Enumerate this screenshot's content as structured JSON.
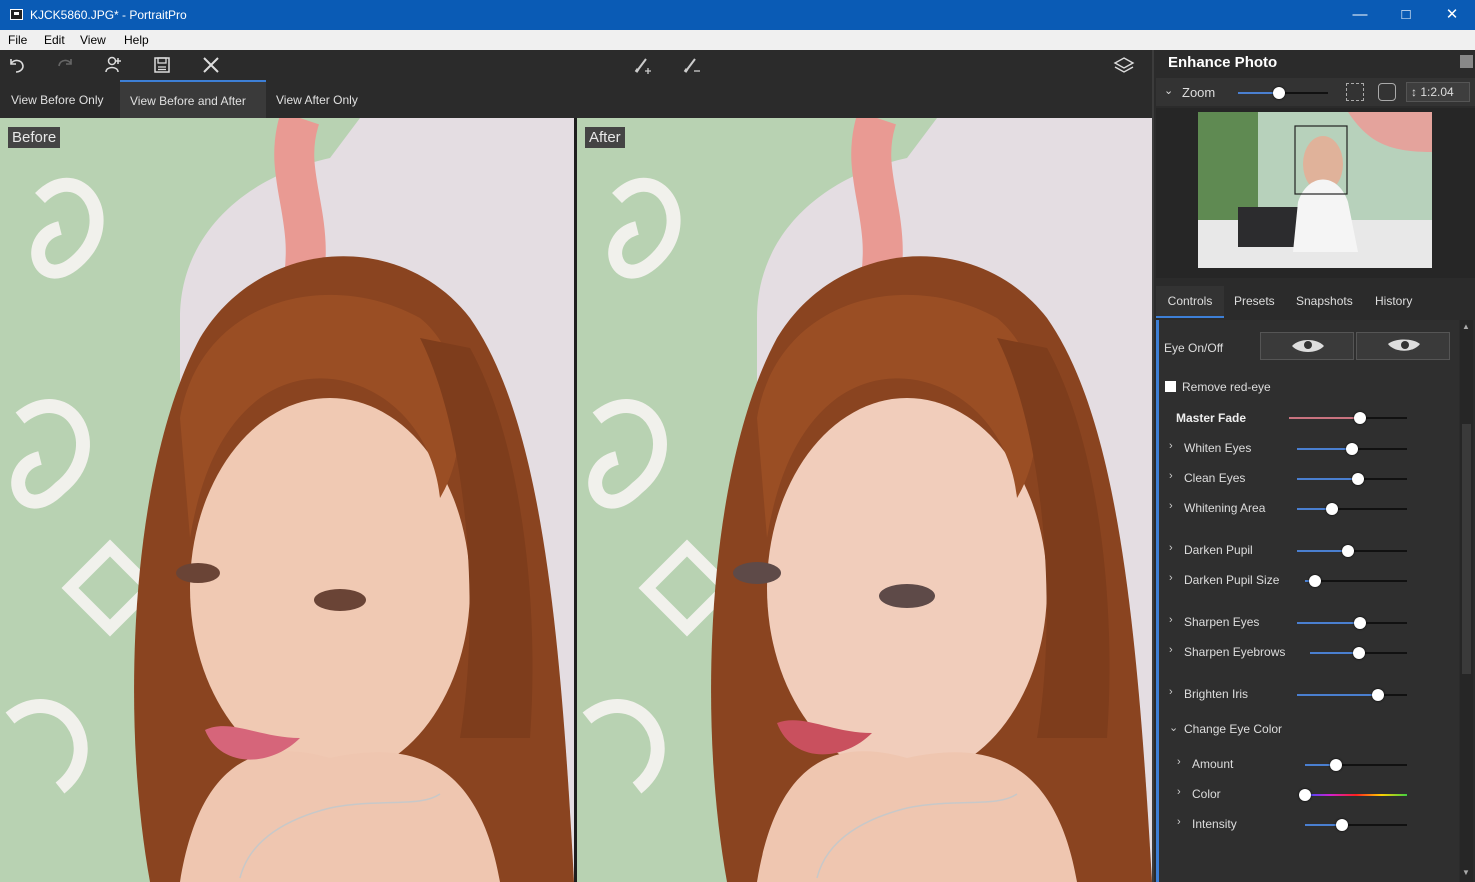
{
  "window": {
    "title": "KJCK5860.JPG* - PortraitPro"
  },
  "menu": {
    "items": [
      "File",
      "Edit",
      "View",
      "Help"
    ]
  },
  "view_tabs": [
    "View Before Only",
    "View Before and After",
    "View After Only"
  ],
  "photos": {
    "before_label": "Before",
    "after_label": "After"
  },
  "panel": {
    "title": "Enhance Photo",
    "zoom_label": "Zoom",
    "zoom_value": "1:2.04",
    "zoom_level": 0.45,
    "tabs": [
      "Controls",
      "Presets",
      "Snapshots",
      "History"
    ]
  },
  "controls": {
    "eye_on_off": "Eye On/Off",
    "remove_red_eye": "Remove red-eye",
    "master_fade": {
      "label": "Master Fade",
      "value": 0.6
    },
    "sliders": [
      {
        "label": "Whiten Eyes",
        "value": 0.5
      },
      {
        "label": "Clean Eyes",
        "value": 0.55
      },
      {
        "label": "Whitening Area",
        "value": 0.32
      },
      {
        "label": "Darken Pupil",
        "value": 0.46
      },
      {
        "label": "Darken Pupil Size",
        "value": 0.1
      },
      {
        "label": "Sharpen Eyes",
        "value": 0.57
      },
      {
        "label": "Sharpen Eyebrows",
        "value": 0.5
      },
      {
        "label": "Brighten Iris",
        "value": 0.74
      },
      {
        "label": "Change Eye Color"
      },
      {
        "label": "Amount",
        "value": 0.3
      },
      {
        "label": "Color",
        "value": 0.0
      },
      {
        "label": "Intensity",
        "value": 0.36
      }
    ]
  },
  "colors": {
    "accent": "#3d7fd6",
    "titlebar": "#0a5bb5",
    "panel_bg": "#2b2b2b"
  },
  "icons": [
    "undo-icon",
    "redo-icon",
    "add-person-icon",
    "save-icon",
    "close-icon",
    "brush-add-icon",
    "brush-subtract-icon",
    "layers-icon",
    "eye-open-icon",
    "eye-closed-icon",
    "fit-icon",
    "face-zoom-icon"
  ]
}
